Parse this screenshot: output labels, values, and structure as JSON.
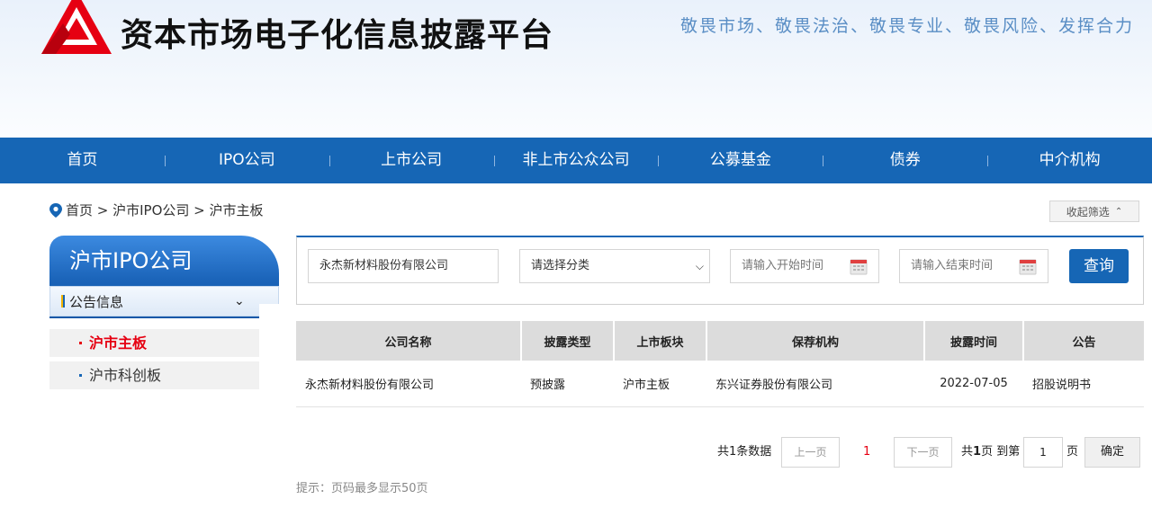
{
  "site": {
    "title": "资本市场电子化信息披露平台",
    "slogan": "敬畏市场、敬畏法治、敬畏专业、敬畏风险、发挥合力"
  },
  "nav": [
    "首页",
    "IPO公司",
    "上市公司",
    "非上市公众公司",
    "公募基金",
    "债券",
    "中介机构"
  ],
  "breadcrumb": "首页 > 沪市IPO公司 > 沪市主板",
  "collapse_label": "收起筛选",
  "sidebar": {
    "title": "沪市IPO公司",
    "dropdown_label": "公告信息",
    "items": [
      {
        "label": "沪市主板",
        "active": true
      },
      {
        "label": "沪市科创板",
        "active": false
      }
    ]
  },
  "filters": {
    "company_value": "永杰新材料股份有限公司",
    "category_placeholder": "请选择分类",
    "start_placeholder": "请输入开始时间",
    "end_placeholder": "请输入结束时间",
    "query_label": "查询"
  },
  "table": {
    "headers": [
      "公司名称",
      "披露类型",
      "上市板块",
      "保荐机构",
      "披露时间",
      "公告"
    ],
    "rows": [
      [
        "永杰新材料股份有限公司",
        "预披露",
        "沪市主板",
        "东兴证券股份有限公司",
        "2022-07-05",
        "招股说明书"
      ]
    ]
  },
  "pager": {
    "total_label": "共1条数据",
    "prev_label": "上一页",
    "current_page": "1",
    "next_label": "下一页",
    "pages_prefix": "共",
    "pages_count": "1",
    "pages_suffix": "页 到第",
    "goto_value": "1",
    "page_label": "页",
    "confirm_label": "确定"
  },
  "hint": "提示：页码最多显示50页",
  "colors": {
    "brand_blue": "#1666b5",
    "logo_red": "#e60012",
    "active_red": "#e60012"
  }
}
